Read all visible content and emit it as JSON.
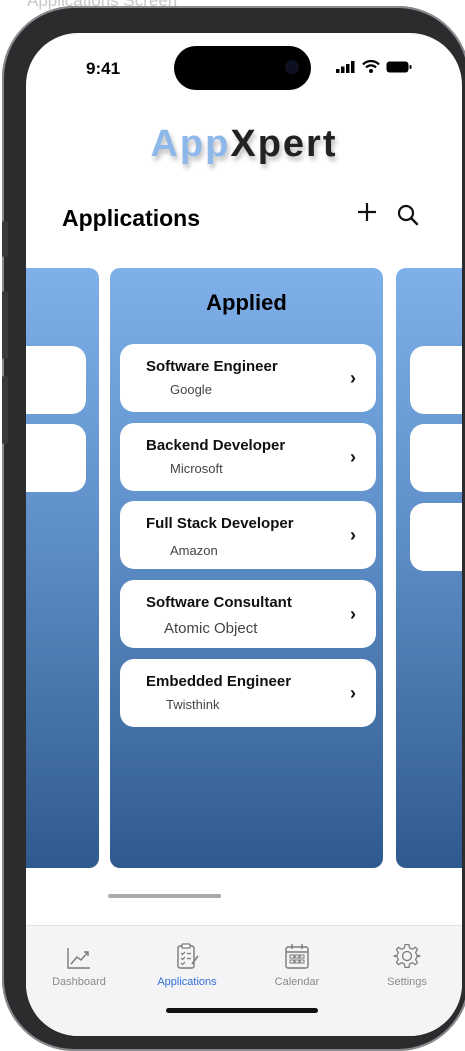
{
  "caption": "Applications Screen",
  "status_bar": {
    "time": "9:41"
  },
  "logo": {
    "part1": "App",
    "part2": "Xpert"
  },
  "header": {
    "title": "Applications",
    "add_icon": "plus-icon",
    "search_icon": "search-icon"
  },
  "board": {
    "column_title": "Applied",
    "cards": [
      {
        "title": "Software Engineer",
        "company": "Google"
      },
      {
        "title": "Backend Developer",
        "company": "Microsoft"
      },
      {
        "title": "Full Stack Developer",
        "company": "Amazon"
      },
      {
        "title": "Software Consultant",
        "company": "Atomic Object"
      },
      {
        "title": "Embedded Engineer",
        "company": "Twisthink"
      }
    ],
    "chevron": "›"
  },
  "tabbar": {
    "items": [
      {
        "label": "Dashboard",
        "icon": "chart-line-icon",
        "active": false
      },
      {
        "label": "Applications",
        "icon": "clipboard-icon",
        "active": true
      },
      {
        "label": "Calendar",
        "icon": "calendar-icon",
        "active": false
      },
      {
        "label": "Settings",
        "icon": "gear-icon",
        "active": false
      }
    ]
  },
  "colors": {
    "accent": "#2f6fd6",
    "logo_light": "#8fb8ea",
    "column_top": "#7fb0ea",
    "column_bottom": "#2f5a8d"
  }
}
